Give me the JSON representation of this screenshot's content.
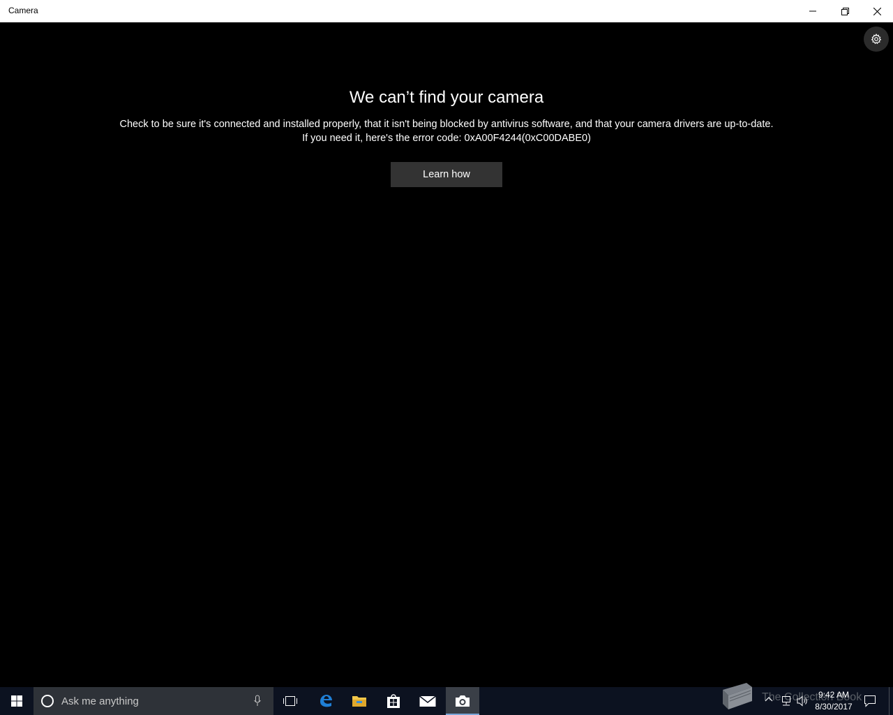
{
  "window": {
    "title": "Camera"
  },
  "error": {
    "title": "We can’t find your camera",
    "line1": "Check to be sure it's connected and installed properly, that it isn't being blocked by antivirus software, and that your camera drivers are up-to-date.",
    "line2": "If you need it, here's the error code: 0xA00F4244(0xC00DABE0)",
    "button_label": "Learn how"
  },
  "taskbar": {
    "search_placeholder": "Ask me anything",
    "pinned": [
      "edge-icon",
      "file-explorer-icon",
      "store-icon",
      "mail-icon",
      "camera-icon"
    ],
    "watermark": "The Collection Book",
    "clock": {
      "time": "9:42 AM",
      "date": "8/30/2017"
    }
  },
  "colors": {
    "background": "#000000",
    "titlebar": "#ffffff",
    "button": "#333333",
    "taskbar": "#0c1220",
    "search_box": "#2e3238",
    "edge_blue": "#1f7fd6",
    "explorer_yellow": "#f4c84a"
  }
}
